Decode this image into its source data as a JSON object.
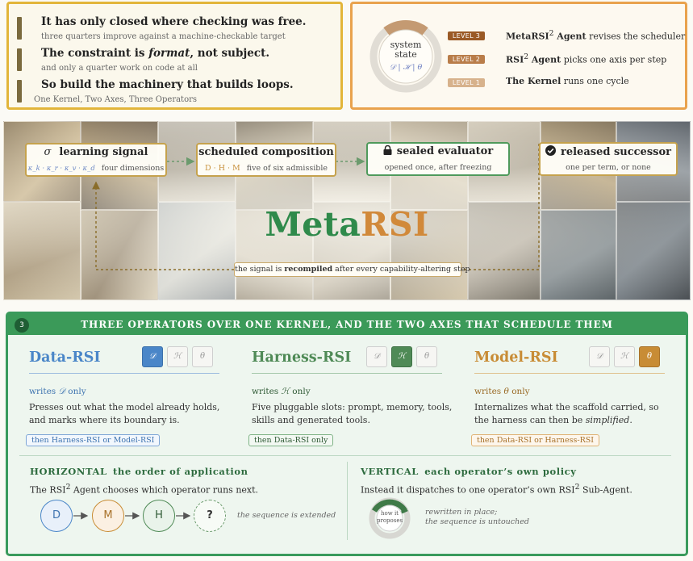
{
  "claims": [
    {
      "head": "It has only closed where checking was free.",
      "sub": "three quarters improve against a machine-checkable target"
    },
    {
      "head_pre": "The constraint is ",
      "head_em": "format",
      "head_post": ", not subject.",
      "sub": "and only a quarter work on code at all"
    },
    {
      "head": "So build the machinery that builds loops.",
      "sub": "One Kernel, Two Axes, Three Operators"
    }
  ],
  "levels": {
    "ring_label_1": "system",
    "ring_label_2": "state",
    "ring_symbols": "𝒟 | ℋ | θ",
    "items": [
      {
        "badge": "LEVEL 3",
        "name": "MetaRSI",
        "sup": "2",
        "name_post": " Agent",
        "desc": " revises the scheduler",
        "color": "#9a5a26"
      },
      {
        "badge": "LEVEL 2",
        "name": "RSI",
        "sup": "2",
        "name_post": " Agent",
        "desc": " picks one axis per step",
        "color": "#b97d4a"
      },
      {
        "badge": "LEVEL 1",
        "name": "The Kernel",
        "sup": "",
        "name_post": "",
        "desc": " runs one cycle",
        "color": "#d7b28c"
      }
    ]
  },
  "hero": {
    "boxes": [
      {
        "icon": "σ",
        "title": "learning signal",
        "sub_syms": "κ_k · κ_r · κ_v · κ_d",
        "sub": "four dimensions"
      },
      {
        "title": "scheduled composition",
        "sub_syms": "D · H · M",
        "sub": "five of six admissible"
      },
      {
        "icon": "lock",
        "title": "sealed evaluator",
        "sub": "opened once, after freezing"
      },
      {
        "icon": "check",
        "title": "released successor",
        "sub": "one per term, or none"
      }
    ],
    "wordmark_a": "Meta",
    "wordmark_b": "RSI",
    "recompile_pre": "the signal is ",
    "recompile_b": "recompiled",
    "recompile_post": " after every capability-altering step"
  },
  "panel": {
    "number": "3",
    "title": "THREE OPERATORS OVER ONE KERNEL, AND THE TWO AXES THAT SCHEDULE THEM",
    "operators": [
      {
        "name": "Data-RSI",
        "writes_pre": "writes ",
        "writes_sym": "𝒟",
        "writes_post": " only",
        "desc": "Presses out what the model already holds, and marks where its boundary is.",
        "then": "then Harness-RSI or Model-RSI",
        "color": "#4a86c8",
        "chips": [
          "𝒟",
          "ℋ",
          "θ"
        ],
        "active": 0
      },
      {
        "name": "Harness-RSI",
        "writes_pre": "writes ",
        "writes_sym": "ℋ",
        "writes_post": " only",
        "desc": "Five pluggable slots: prompt, memory, tools, skills and generated tools.",
        "then": "then Data-RSI only",
        "color": "#4f8a56",
        "chips": [
          "𝒟",
          "ℋ",
          "θ"
        ],
        "active": 1
      },
      {
        "name": "Model-RSI",
        "writes_pre": "writes ",
        "writes_sym": "θ",
        "writes_post": " only",
        "desc_pre": "Internalizes what the scaffold carried, so the harness can then be ",
        "desc_em": "simplified",
        "desc_post": ".",
        "then": "then Data-RSI or Harness-RSI",
        "color": "#c88c35",
        "chips": [
          "𝒟",
          "ℋ",
          "θ"
        ],
        "active": 2
      }
    ],
    "horizontal": {
      "label": "HORIZONTAL",
      "title": "the order of application",
      "text_pre": "The RSI",
      "text_sup": "2",
      "text_post": " Agent chooses which operator runs next.",
      "nodes": [
        "D",
        "M",
        "H",
        "?"
      ],
      "note": "the sequence is extended"
    },
    "vertical": {
      "label": "VERTICAL",
      "title": "each operator’s own policy",
      "text_pre": "Instead it dispatches to one operator’s own RSI",
      "text_sup": "2",
      "text_post": " Sub-Agent.",
      "dial_1": "how it",
      "dial_2": "proposes",
      "note_1": "rewritten in place;",
      "note_2": "the sequence is untouched"
    }
  },
  "colors": {
    "gold": "#e2b53a",
    "orange": "#e9a24d",
    "green": "#3a9a5c",
    "data_blue": "#4a86c8",
    "harness_green": "#4f8a56",
    "model_orange": "#c88c35",
    "meta_green": "#2f8a4b",
    "rsi_orange": "#d1893a"
  }
}
